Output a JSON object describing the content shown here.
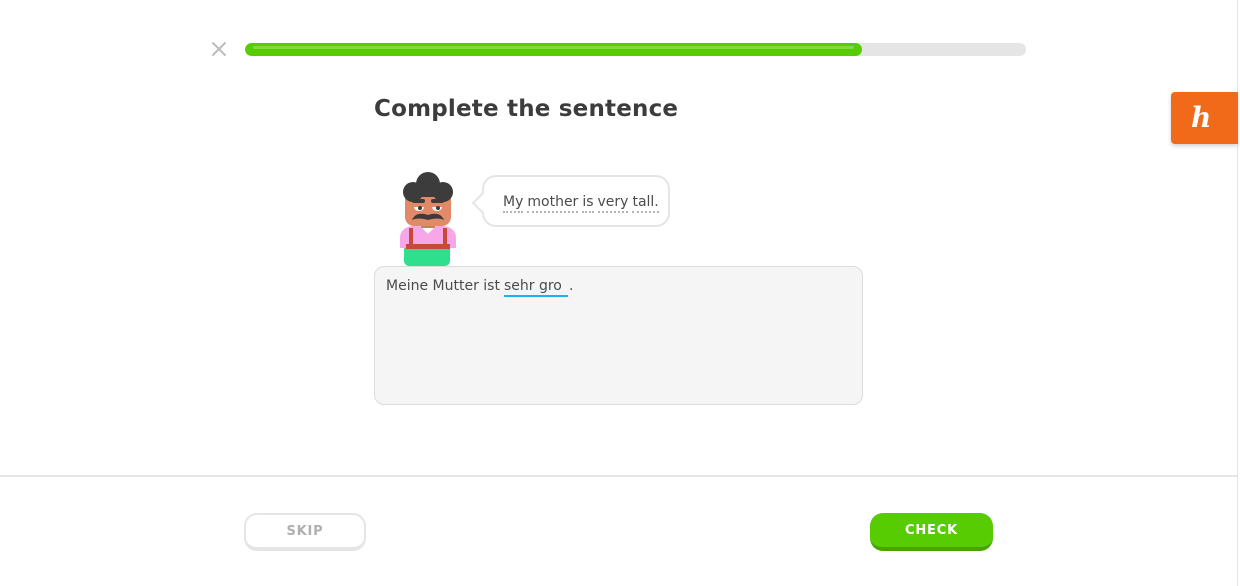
{
  "lesson": {
    "progress_fraction": 0.79
  },
  "heading": "Complete the sentence",
  "prompt": {
    "hint_words": [
      "My",
      "mother",
      "is",
      "very",
      "tall."
    ]
  },
  "answer": {
    "prefix": "Meine Mutter ist",
    "input_value": "sehr gro",
    "suffix": "."
  },
  "footer": {
    "skip_label": "SKIP",
    "check_label": "CHECK"
  },
  "extension": {
    "badge_glyph": "h"
  },
  "colors": {
    "progress": "#58cc02",
    "check_button": "#58cc02",
    "input_underline": "#1cb0f6",
    "extension_badge": "#f06a1a"
  },
  "icons": {
    "close": "close-icon",
    "character": "character-illustration"
  }
}
